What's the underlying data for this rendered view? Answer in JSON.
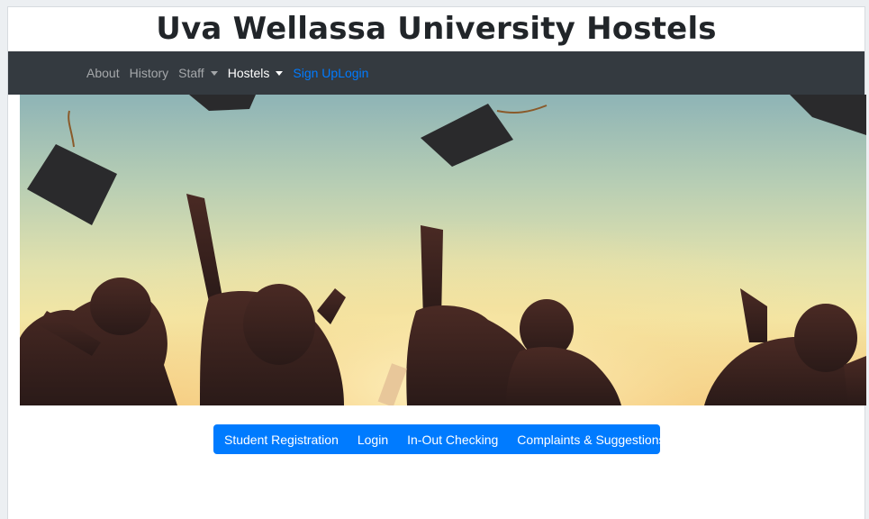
{
  "site": {
    "title": "Uva Wellassa University Hostels"
  },
  "nav": {
    "items": [
      {
        "label": "About"
      },
      {
        "label": "History"
      },
      {
        "label": "Staff"
      },
      {
        "label": "Hostels"
      },
      {
        "label": "Sign Up"
      },
      {
        "label": "Login"
      }
    ]
  },
  "hero": {
    "image": "graduation-silhouettes"
  },
  "actions": {
    "buttons": [
      {
        "label": "Student Registration"
      },
      {
        "label": "Login"
      },
      {
        "label": "In-Out Checking"
      },
      {
        "label": "Complaints & Suggestions"
      }
    ],
    "color": "#007bff"
  },
  "colors": {
    "navbar": "#343a40",
    "accent": "#007bff"
  }
}
